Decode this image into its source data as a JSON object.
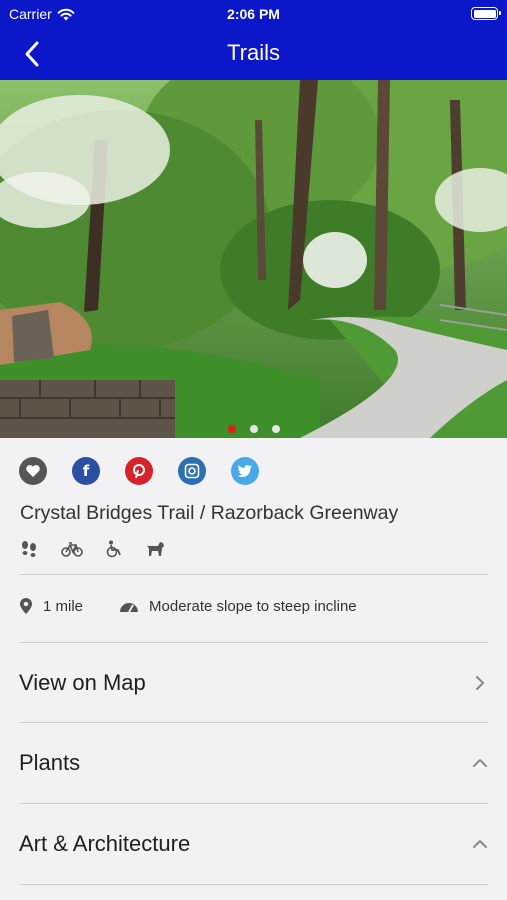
{
  "status_bar": {
    "carrier": "Carrier",
    "time": "2:06 PM"
  },
  "nav": {
    "title": "Trails"
  },
  "hero": {
    "slides": 3,
    "active_slide": 1
  },
  "share": [
    "heart-icon",
    "facebook-icon",
    "pinterest-icon",
    "instagram-icon",
    "twitter-icon"
  ],
  "trail": {
    "name": "Crystal Bridges Trail / Razorback Greenway"
  },
  "activities": [
    "hiking-icon",
    "bicycle-icon",
    "wheelchair-icon",
    "dog-icon"
  ],
  "facts": {
    "distance": "1 mile",
    "slope": "Moderate slope to steep incline"
  },
  "rows": [
    {
      "label": "View on Map",
      "icon": "chevron-right-icon"
    },
    {
      "label": "Plants",
      "icon": "chevron-up-icon"
    },
    {
      "label": "Art & Architecture",
      "icon": "chevron-up-icon"
    }
  ],
  "colors": {
    "nav": "#0b17c8",
    "active_dot": "#e31b1b"
  }
}
